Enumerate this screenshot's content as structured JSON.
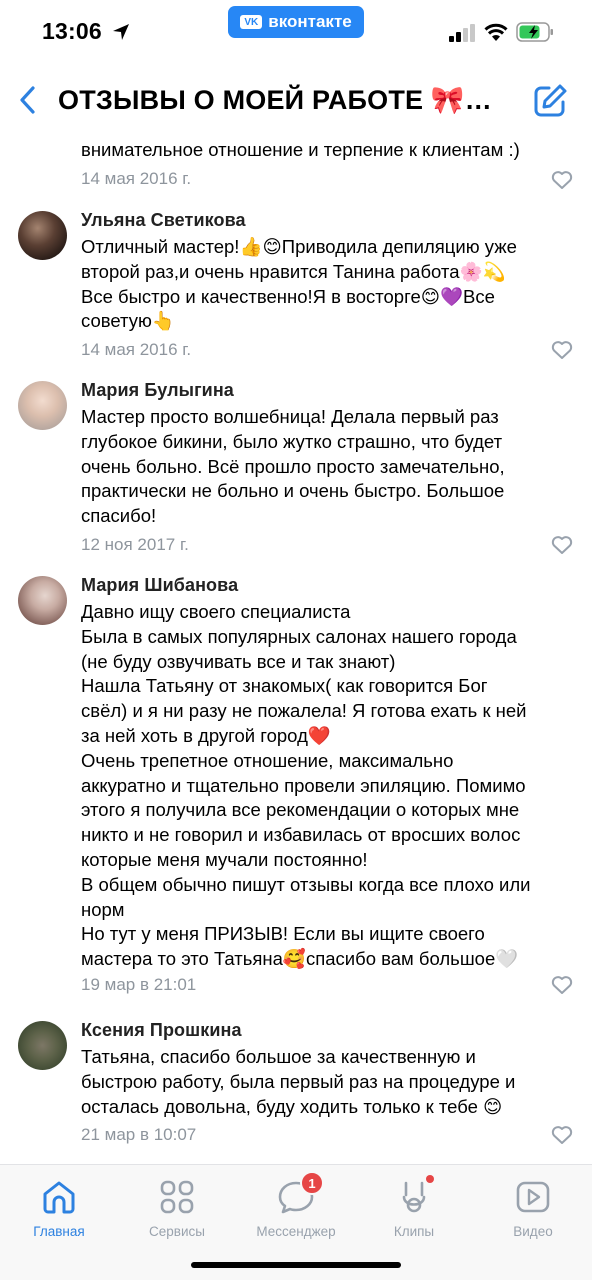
{
  "status_bar": {
    "time": "13:06",
    "app_label": "вконтакте",
    "app_logo": "vk"
  },
  "header": {
    "title": "ОТЗЫВЫ О МОЕЙ РАБОТЕ 🎀…"
  },
  "reviews": [
    {
      "author": "",
      "lines": [
        "внимательное отношение и терпение к клиентам :)"
      ],
      "date": "14 мая 2016 г."
    },
    {
      "author": "Ульяна Светикова",
      "lines": [
        "Отличный мастер!👍😊Приводила депиляцию  уже",
        "второй раз,и очень нравится Танина работа🌸💫",
        "Все быстро и качественно!Я в восторге😊💜Все",
        "советую👆"
      ],
      "date": "14 мая 2016 г."
    },
    {
      "author": "Мария Булыгина",
      "lines": [
        "Мастер просто волшебница! Делала первый раз",
        "глубокое бикини, было жутко страшно, что будет",
        "очень больно.  Всё прошло просто замечательно,",
        "практически не больно  и очень быстро. Большое",
        "спасибо!"
      ],
      "date": "12 ноя 2017 г."
    },
    {
      "author": "Мария Шибанова",
      "lines": [
        "Давно ищу своего специалиста",
        "Была в самых популярных салонах нашего города",
        "(не буду озвучивать все и так знают)",
        "Нашла Татьяну от знакомых( как говорится Бог",
        "свёл) и я ни разу не пожалела! Я готова ехать к ней",
        "за ней хоть в другой город❤️",
        "Очень трепетное отношение, максимально",
        "аккуратно и тщательно провели эпиляцию. Помимо",
        "этого я получила все рекомендации о которых мне",
        "никто и не говорил и избавилась от вросших волос",
        "которые меня мучали постоянно!",
        "В общем обычно пишут отзывы когда все плохо или",
        "норм",
        "Но тут у меня ПРИЗЫВ! Если вы ищите своего",
        "мастера то это Татьяна🥰спасибо вам большое🤍"
      ],
      "date": "19 мар в 21:01"
    },
    {
      "author": "Ксения Прошкина",
      "lines": [
        "Татьяна, спасибо  большое за качественную и",
        "быстрою работу, была первый раз на процедуре и",
        "осталась довольна, буду ходить только к тебе 😊"
      ],
      "date": "21 мар в 10:07"
    }
  ],
  "tabbar": {
    "home": "Главная",
    "services": "Сервисы",
    "messenger": "Мессенджер",
    "messenger_badge": "1",
    "clips": "Клипы",
    "video": "Видео"
  },
  "colors": {
    "accent": "#2d81e0",
    "vk_blue": "#2787f5",
    "muted": "#99a2ad",
    "badge": "#e64646"
  }
}
